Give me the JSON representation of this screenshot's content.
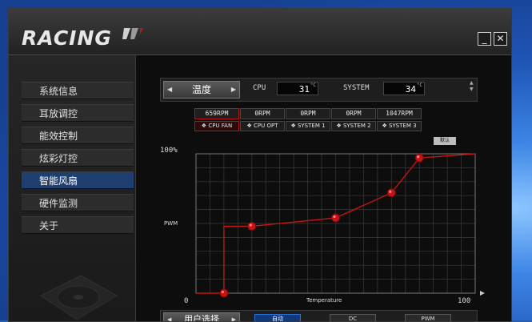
{
  "app": {
    "logo_text": "RACING",
    "minimize_glyph": "_",
    "close_glyph": "✕"
  },
  "sidebar": {
    "items": [
      {
        "label": "系统信息",
        "active": false
      },
      {
        "label": "耳放调控",
        "active": false
      },
      {
        "label": "能效控制",
        "active": false
      },
      {
        "label": "炫彩灯控",
        "active": false
      },
      {
        "label": "智能风扇",
        "active": true
      },
      {
        "label": "硬件监测",
        "active": false
      },
      {
        "label": "关于",
        "active": false
      }
    ]
  },
  "temperature_bar": {
    "selector_label": "温度",
    "cpu_label": "CPU",
    "cpu_value": "31",
    "system_label": "SYSTEM",
    "system_value": "34",
    "unit": "°C"
  },
  "fans": {
    "rpm": [
      "659RPM",
      "0RPM",
      "0RPM",
      "0RPM",
      "1047RPM"
    ],
    "tabs": [
      "CPU FAN",
      "CPU OPT",
      "SYSTEM 1",
      "SYSTEM 2",
      "SYSTEM 3"
    ],
    "active_index": 0,
    "default_label": "默认"
  },
  "chart_data": {
    "type": "line",
    "y_top_label": "100%",
    "ylabel": "PWM",
    "xlabel": "Temperature",
    "x_min_label": "0",
    "x_max_label": "100",
    "xlim": [
      0,
      100
    ],
    "ylim": [
      0,
      100
    ],
    "grid": true,
    "series": [
      {
        "x": [
          10,
          20,
          50,
          70,
          80,
          100
        ],
        "y": [
          0,
          48,
          54,
          72,
          97,
          100
        ]
      }
    ],
    "line_color": "#c41414",
    "point_color": "#c41414"
  },
  "bottom_bar": {
    "selector_label": "用户选择",
    "modes": [
      {
        "label": "自动",
        "active": true
      },
      {
        "label": "DC",
        "active": false
      },
      {
        "label": "PWM",
        "active": false
      }
    ]
  },
  "colors": {
    "accent_red": "#c41414",
    "active_blue": "#1f3f70"
  }
}
